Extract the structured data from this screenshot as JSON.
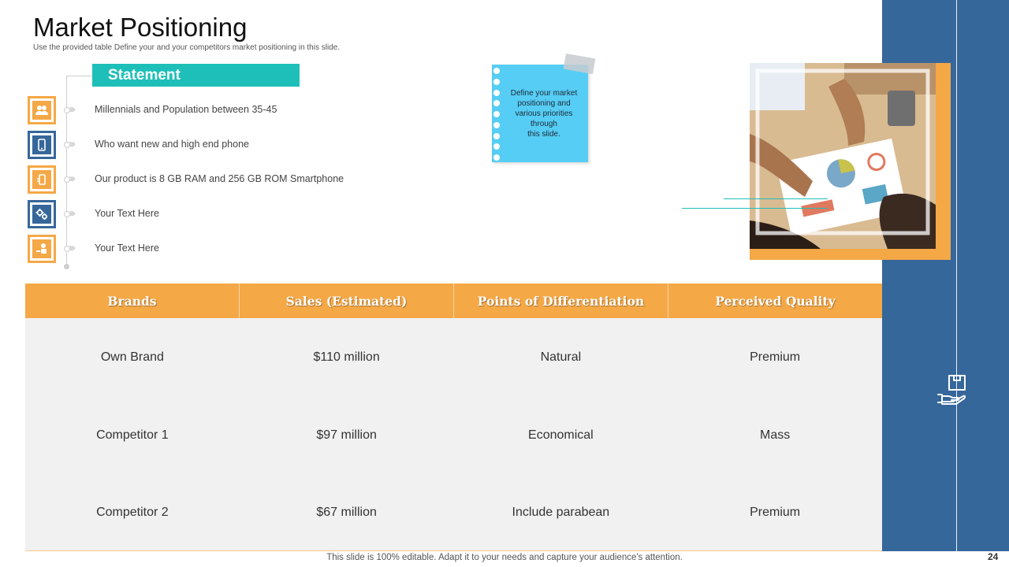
{
  "slide": {
    "title": "Market Positioning",
    "subtitle": "Use the provided table Define your and your competitors  market positioning in this slide.",
    "page_number": "24",
    "footer": "This slide is 100% editable. Adapt it to your needs and capture your audience's attention."
  },
  "statement": {
    "header": "Statement",
    "items": [
      {
        "text": "Millennials  and Population between 35-45",
        "icon": "users-icon",
        "color": "#f5a846"
      },
      {
        "text": "Who want new and high end phone",
        "icon": "phone-icon",
        "color": "#36679a"
      },
      {
        "text": "Our product is 8 GB RAM and 256 GB ROM Smartphone",
        "icon": "smartphone-icon",
        "color": "#f5a846"
      },
      {
        "text": "Your Text Here",
        "icon": "gears-icon",
        "color": "#36679a"
      },
      {
        "text": "Your Text Here",
        "icon": "money-hand-icon",
        "color": "#f5a846"
      }
    ]
  },
  "sticky_note": {
    "text_lines": [
      "Define your market",
      "positioning and",
      "various priorities",
      "through",
      "this slide."
    ]
  },
  "table": {
    "headers": [
      "Brands",
      "Sales (Estimated)",
      "Points of Differentiation",
      "Perceived Quality"
    ],
    "rows": [
      [
        "Own Brand",
        "$110 million",
        "Natural",
        "Premium"
      ],
      [
        "Competitor 1",
        "$97 million",
        "Economical",
        "Mass"
      ],
      [
        "Competitor 2",
        "$67 million",
        "Include  parabean",
        "Premium"
      ]
    ]
  },
  "colors": {
    "accent_orange": "#f5a846",
    "accent_teal": "#1ebfb8",
    "accent_blue": "#36679a",
    "sticky_blue": "#56cdf5"
  }
}
